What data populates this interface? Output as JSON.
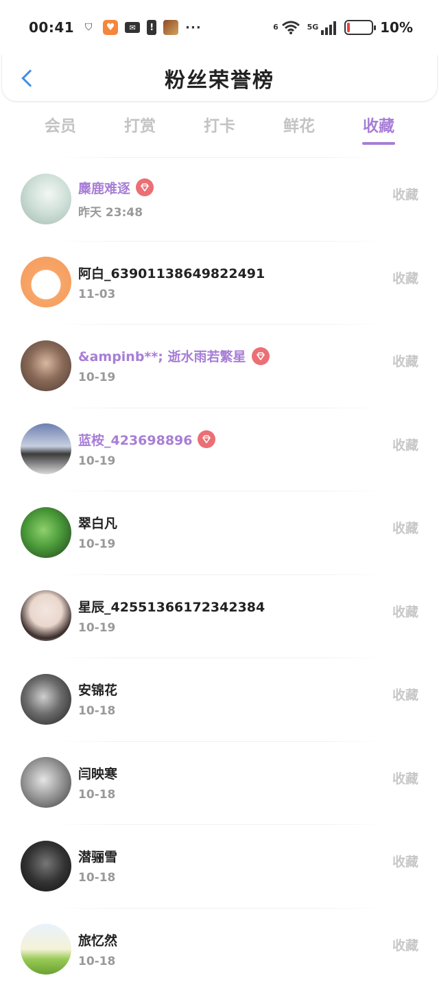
{
  "status_bar": {
    "time": "00:41",
    "network": "5G",
    "wifi_sub": "6",
    "battery_pct": "10%",
    "battery_level": 0.1,
    "more": "···"
  },
  "header": {
    "title": "粉丝荣誉榜"
  },
  "tabs": [
    {
      "label": "会员",
      "active": false
    },
    {
      "label": "打赏",
      "active": false
    },
    {
      "label": "打卡",
      "active": false
    },
    {
      "label": "鲜花",
      "active": false
    },
    {
      "label": "收藏",
      "active": true
    }
  ],
  "colors": {
    "accent": "#a77ed6",
    "back": "#3d8fe6",
    "vip_badge": "#eb6f74",
    "muted": "#c8c8c8"
  },
  "rows": [
    {
      "name": "麋鹿难逐",
      "time": "昨天 23:48",
      "vip": true,
      "action": "收藏"
    },
    {
      "name": "阿白_63901138649822491",
      "time": "11-03",
      "vip": false,
      "action": "收藏"
    },
    {
      "name": "&ampinb**; 逝水雨若繁星",
      "time": "10-19",
      "vip": true,
      "action": "收藏"
    },
    {
      "name": "蓝桉_423698896",
      "time": "10-19",
      "vip": true,
      "action": "收藏"
    },
    {
      "name": "翠白凡",
      "time": "10-19",
      "vip": false,
      "action": "收藏"
    },
    {
      "name": "星辰_42551366172342384",
      "time": "10-19",
      "vip": false,
      "action": "收藏"
    },
    {
      "name": "安锦花",
      "time": "10-18",
      "vip": false,
      "action": "收藏"
    },
    {
      "name": "闫映寒",
      "time": "10-18",
      "vip": false,
      "action": "收藏"
    },
    {
      "name": "潜骊雪",
      "time": "10-18",
      "vip": false,
      "action": "收藏"
    },
    {
      "name": "旅忆然",
      "time": "10-18",
      "vip": false,
      "action": "收藏"
    }
  ]
}
